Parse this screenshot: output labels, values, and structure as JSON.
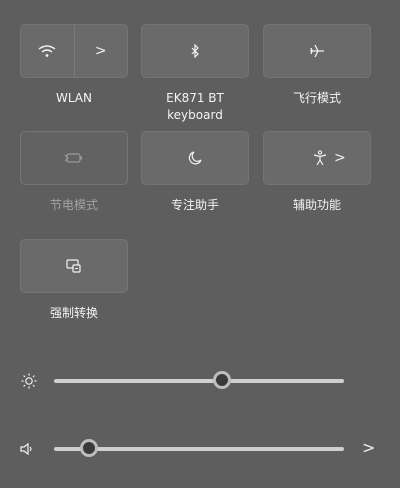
{
  "tiles": [
    {
      "key": "wlan",
      "label": "WLAN",
      "icon": "wifi-icon",
      "has_arrow": true,
      "disabled": false
    },
    {
      "key": "bluetooth",
      "label": "EK871 BT\nkeyboard",
      "icon": "bluetooth-icon",
      "has_arrow": false,
      "disabled": false
    },
    {
      "key": "airplane",
      "label": "飞行模式",
      "icon": "airplane-icon",
      "has_arrow": false,
      "disabled": false
    },
    {
      "key": "battery-saver",
      "label": "节电模式",
      "icon": "battery-saver-icon",
      "has_arrow": false,
      "disabled": true
    },
    {
      "key": "focus",
      "label": "专注助手",
      "icon": "moon-icon",
      "has_arrow": false,
      "disabled": false
    },
    {
      "key": "accessibility",
      "label": "辅助功能",
      "icon": "accessibility-icon",
      "has_arrow": true,
      "disabled": false
    },
    {
      "key": "project",
      "label": "强制转换",
      "icon": "cast-icon",
      "has_arrow": false,
      "disabled": false
    }
  ],
  "arrow_glyph": ">",
  "brightness": {
    "icon": "sun-icon",
    "level": 0.58
  },
  "volume": {
    "icon": "speaker-icon",
    "level": 0.12,
    "arrow": ">"
  },
  "colors": {
    "panel_bg": "#5e5e5e",
    "tile_bg": "#6a6a6a",
    "track": "#cfcfcf"
  }
}
